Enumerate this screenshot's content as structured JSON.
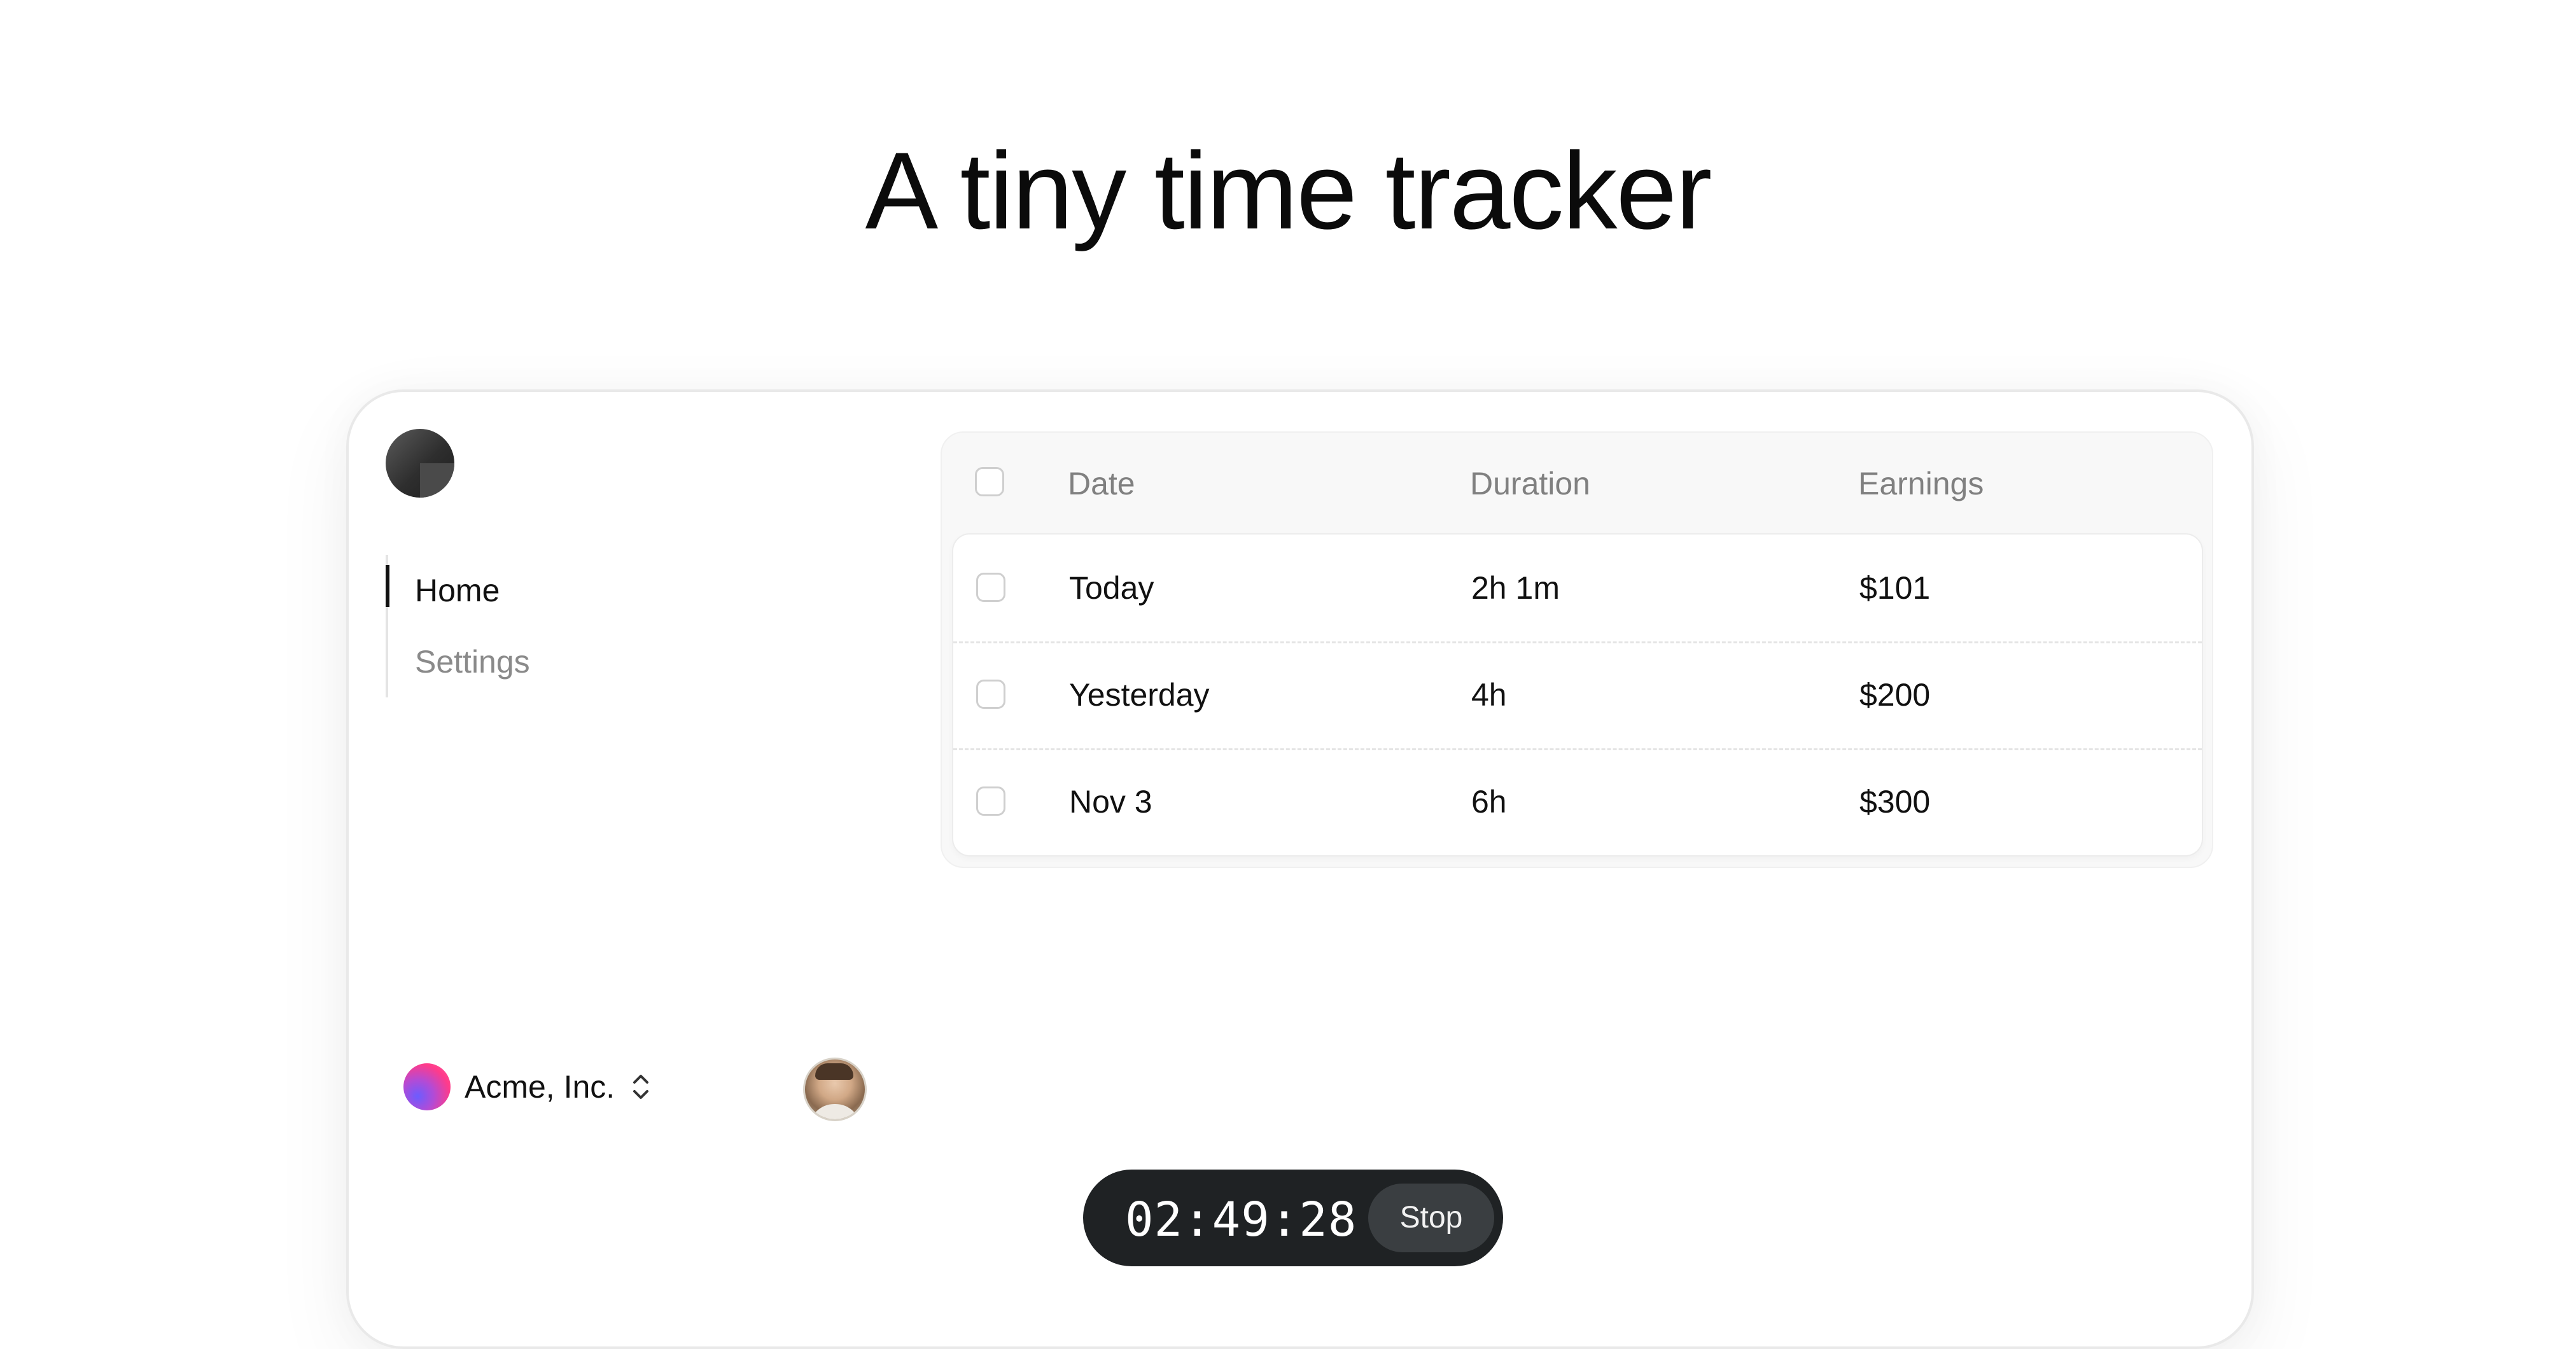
{
  "headline": "A tiny time tracker",
  "nav": {
    "items": [
      {
        "label": "Home",
        "active": true
      },
      {
        "label": "Settings",
        "active": false
      }
    ]
  },
  "org": {
    "name": "Acme, Inc.",
    "icon": "chevron-up-down-icon"
  },
  "table": {
    "headers": {
      "date": "Date",
      "duration": "Duration",
      "earnings": "Earnings"
    },
    "rows": [
      {
        "date": "Today",
        "duration": "2h 1m",
        "earnings": "$101"
      },
      {
        "date": "Yesterday",
        "duration": "4h",
        "earnings": "$200"
      },
      {
        "date": "Nov 3",
        "duration": "6h",
        "earnings": "$300"
      }
    ]
  },
  "timer": {
    "time": "02:49:28",
    "stop_label": "Stop"
  },
  "colors": {
    "timer_bg": "#1f2224",
    "active_nav": "#111111"
  }
}
